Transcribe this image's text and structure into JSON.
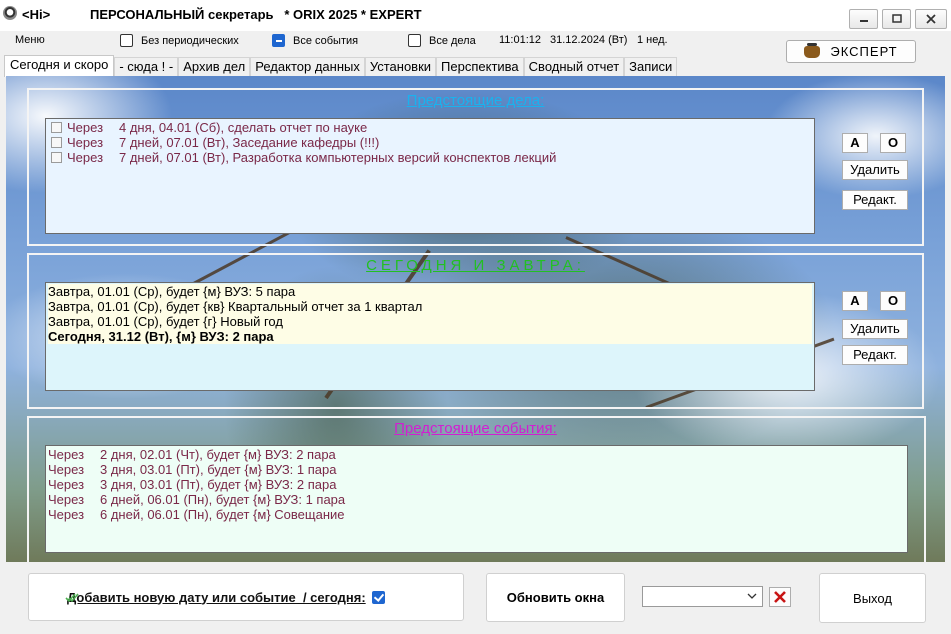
{
  "titlebar": {
    "prefix": "<Hi>",
    "title": "ПЕРСОНАЛЬНЫЙ секретарь   * ORIX 2025 * EXPERT"
  },
  "options": {
    "menu_label": "Меню",
    "no_periodic": {
      "label": "Без периодических",
      "checked": false
    },
    "all_events": {
      "label": "Все события",
      "checked": true
    },
    "all_tasks": {
      "label": "Все дела",
      "checked": false
    },
    "clock": "11:01:12",
    "date": "31.12.2024 (Вт)",
    "week": "1 нед.",
    "expert_label": "ЭКСПЕРТ"
  },
  "tabs": [
    {
      "label": "Сегодня и скоро",
      "active": true
    },
    {
      "label": "- сюда ! -"
    },
    {
      "label": "Архив дел"
    },
    {
      "label": "Редактор данных"
    },
    {
      "label": "Установки"
    },
    {
      "label": "Перспектива"
    },
    {
      "label": "Сводный отчет"
    },
    {
      "label": "Записи"
    }
  ],
  "upcoming_tasks": {
    "title": "Предстоящие дела:",
    "items": [
      {
        "prefix": "Через",
        "text": "4 дня, 04.01 (Сб), сделать отчет по науке"
      },
      {
        "prefix": "Через",
        "text": "7 дней, 07.01 (Вт), Заседание кафедры (!!!)"
      },
      {
        "prefix": "Через",
        "text": "7 дней, 07.01 (Вт), Разработка компьютерных версий конспектов лекций"
      }
    ],
    "btn_font_a": "А",
    "btn_font_o": "О",
    "btn_delete": "Удалить",
    "btn_edit": "Редакт."
  },
  "today_tomorrow": {
    "title": "СЕГОДНЯ И ЗАВТРА:",
    "items": [
      {
        "text": "Завтра, 01.01 (Ср), будет {м} ВУЗ: 5 пара",
        "bold": false
      },
      {
        "text": "Завтра, 01.01 (Ср), будет {кв} Квартальный отчет за 1 квартал",
        "bold": false
      },
      {
        "text": "Завтра, 01.01 (Ср), будет {г} Новый год",
        "bold": false
      },
      {
        "text": "Сегодня, 31.12 (Вт), {м} ВУЗ: 2 пара",
        "bold": true
      }
    ],
    "btn_font_a": "А",
    "btn_font_o": "О",
    "btn_delete": "Удалить",
    "btn_edit": "Редакт."
  },
  "upcoming_events": {
    "title": "Предстоящие события:",
    "items": [
      {
        "prefix": "Через",
        "text": "2 дня, 02.01 (Чт), будет {м} ВУЗ: 2 пара"
      },
      {
        "prefix": "Через",
        "text": "3 дня, 03.01 (Пт), будет {м} ВУЗ: 1 пара"
      },
      {
        "prefix": "Через",
        "text": "3 дня, 03.01 (Пт), будет {м} ВУЗ: 2 пара"
      },
      {
        "prefix": "Через",
        "text": "6 дней, 06.01 (Пн), будет {м} ВУЗ: 1 пара"
      },
      {
        "prefix": "Через",
        "text": "6 дней, 06.01 (Пн), будет {м} Совещание"
      }
    ]
  },
  "bottom": {
    "add_label": "Добавить новую дату или событие  / сегодня:",
    "add_today_checked": true,
    "refresh_label": "Обновить окна",
    "combo_value": "",
    "exit_label": "Выход"
  },
  "colors": {
    "tasks_title": "#1ab2ee",
    "today_title": "#22c022",
    "events_title": "#d21ed2",
    "list_text": "#7a2848"
  }
}
